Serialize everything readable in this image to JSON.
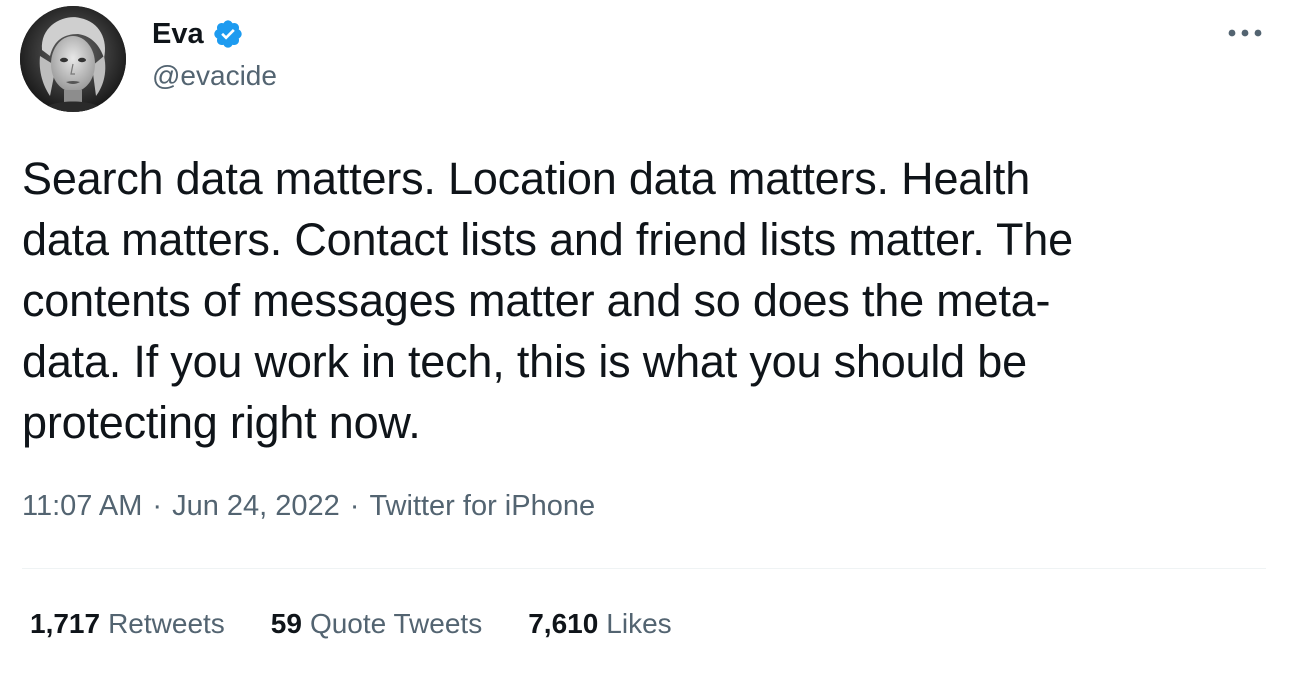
{
  "author": {
    "name": "Eva",
    "handle": "@evacide",
    "verified": true,
    "verified_color": "#1d9bf0"
  },
  "tweet": {
    "text": "Search data matters. Location data matters. Health\ndata matters. Contact lists and friend lists matter. The\ncontents of messages matter and so does the meta-\ndata. If you work in tech, this is what you should be\nprotecting right now.",
    "time": "11:07 AM",
    "separator": "·",
    "date": "Jun 24, 2022",
    "source": "Twitter for iPhone"
  },
  "stats": {
    "retweets_count": "1,717",
    "retweets_label": "Retweets",
    "quotes_count": "59",
    "quotes_label": "Quote Tweets",
    "likes_count": "7,610",
    "likes_label": "Likes"
  },
  "icons": {
    "more": "more-horizontal-icon",
    "verified": "verified-badge-icon"
  },
  "colors": {
    "text_primary": "#0f1419",
    "text_secondary": "#536471",
    "divider": "#eff3f4"
  }
}
